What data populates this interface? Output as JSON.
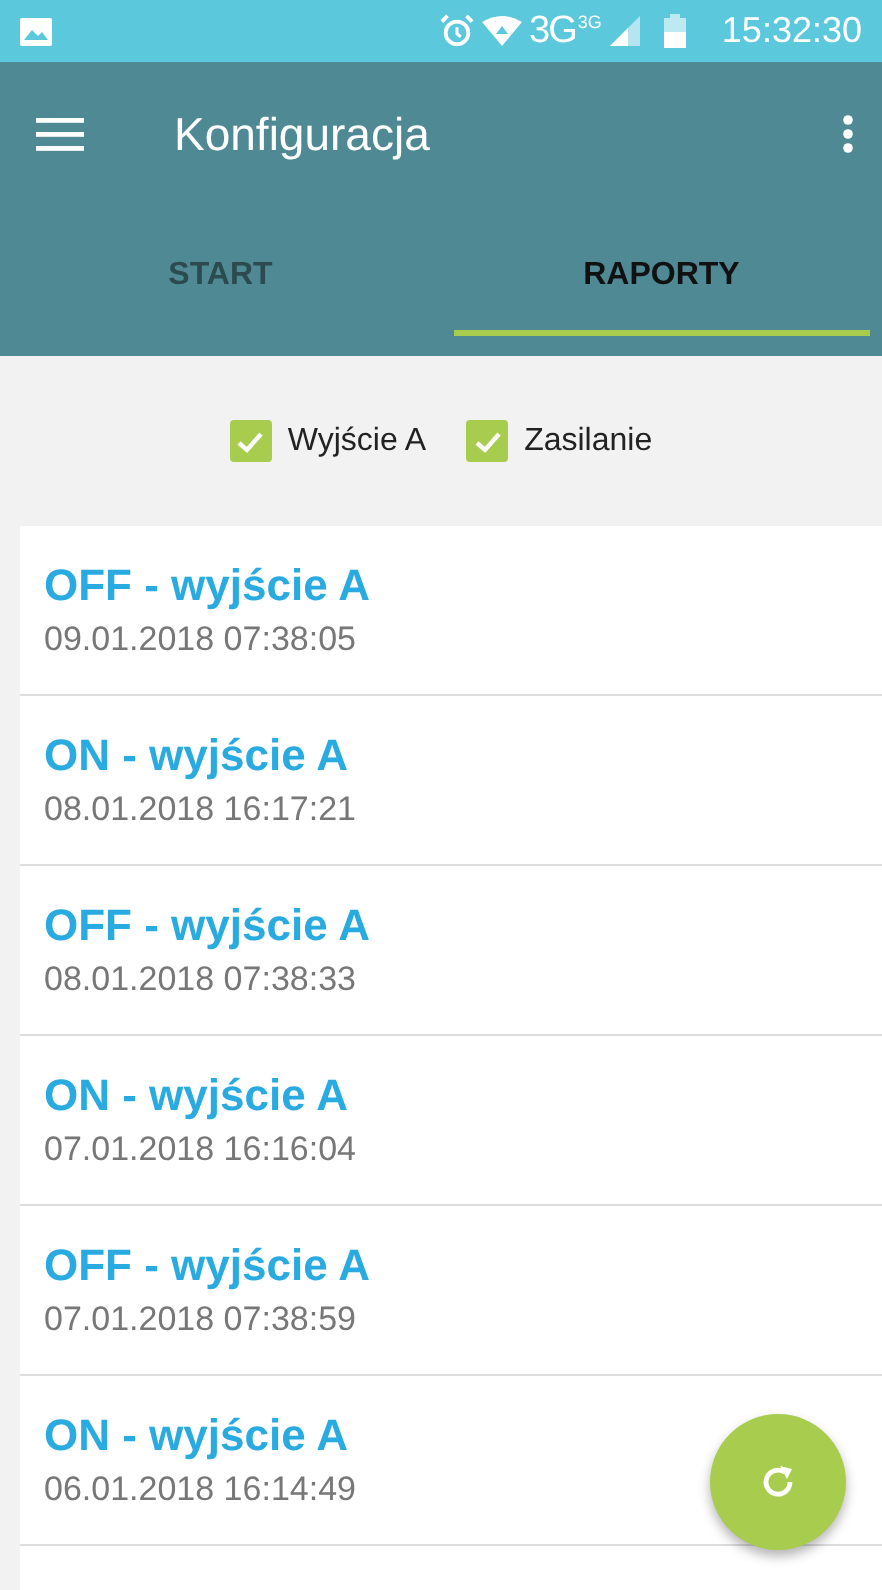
{
  "status_bar": {
    "network": "3G",
    "network_small": "3G",
    "time": "15:32:30"
  },
  "toolbar": {
    "title": "Konfiguracja"
  },
  "tabs": [
    {
      "label": "START",
      "selected": false
    },
    {
      "label": "RAPORTY",
      "selected": true
    }
  ],
  "filters": [
    {
      "label": "Wyjście A",
      "checked": true
    },
    {
      "label": "Zasilanie",
      "checked": true
    }
  ],
  "reports": [
    {
      "title": "OFF - wyjście A",
      "date": "09.01.2018 07:38:05"
    },
    {
      "title": "ON - wyjście A",
      "date": "08.01.2018 16:17:21"
    },
    {
      "title": "OFF - wyjście A",
      "date": "08.01.2018 07:38:33"
    },
    {
      "title": "ON - wyjście A",
      "date": "07.01.2018 16:16:04"
    },
    {
      "title": "OFF - wyjście A",
      "date": "07.01.2018 07:38:59"
    },
    {
      "title": "ON - wyjście A",
      "date": "06.01.2018 16:14:49"
    }
  ]
}
